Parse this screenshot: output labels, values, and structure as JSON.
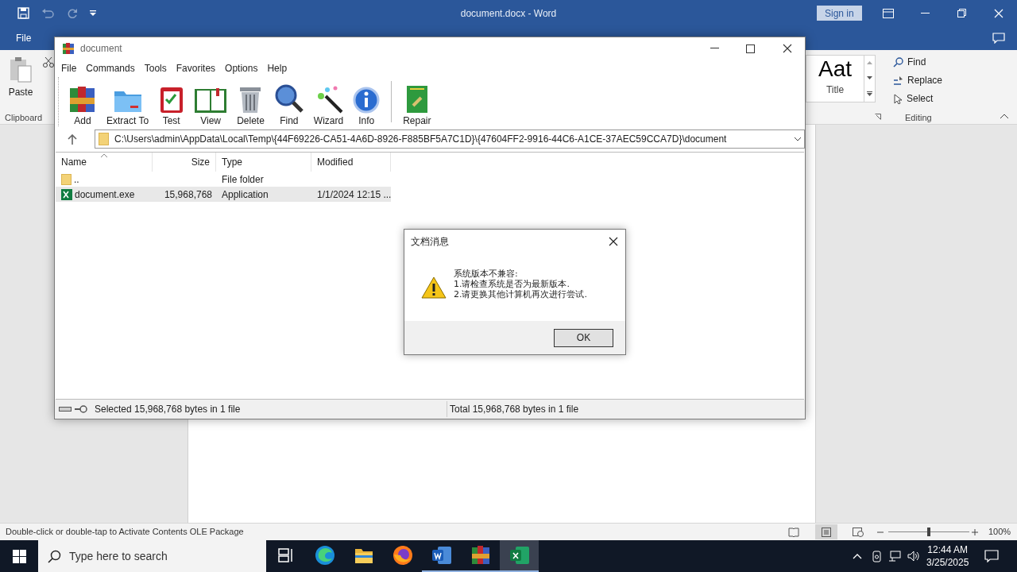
{
  "word": {
    "title": "document.docx  -  Word",
    "sign_in": "Sign in",
    "file_tab": "File",
    "clipboard": {
      "paste": "Paste",
      "label": "Clipboard"
    },
    "styles": {
      "preview": "Aat",
      "name": "Title"
    },
    "editing": {
      "items": [
        "Find",
        "Replace",
        "Select"
      ],
      "label": "Editing"
    },
    "status": "Double-click or double-tap to Activate Contents OLE Package",
    "zoom": {
      "level": 0.5,
      "reading": "100%"
    }
  },
  "winrar": {
    "title": "document",
    "menu": [
      "File",
      "Commands",
      "Tools",
      "Favorites",
      "Options",
      "Help"
    ],
    "toolbar": [
      {
        "kind": "add",
        "label": "Add"
      },
      {
        "kind": "extract",
        "label": "Extract To"
      },
      {
        "kind": "test",
        "label": "Test"
      },
      {
        "kind": "view",
        "label": "View"
      },
      {
        "kind": "delete",
        "label": "Delete"
      },
      {
        "kind": "find",
        "label": "Find"
      },
      {
        "kind": "wizard",
        "label": "Wizard"
      },
      {
        "kind": "info",
        "label": "Info"
      },
      {
        "kind": "repair",
        "label": "Repair"
      }
    ],
    "path": "C:\\Users\\admin\\AppData\\Local\\Temp\\{44F69226-CA51-4A6D-8926-F885BF5A7C1D}\\{47604FF2-9916-44C6-A1CE-37AEC59CCA7D}\\document",
    "columns": [
      "Name",
      "Size",
      "Type",
      "Modified"
    ],
    "rows": [
      {
        "kind": "folder",
        "name": "..",
        "size": "",
        "type": "File folder",
        "modified": "",
        "selected": false
      },
      {
        "kind": "excel",
        "name": "document.exe",
        "size": "15,968,768",
        "type": "Application",
        "modified": "1/1/2024 12:15 ...",
        "selected": true
      }
    ],
    "status_left": "Selected 15,968,768 bytes in 1 file",
    "status_right": "Total 15,968,768 bytes in 1 file"
  },
  "dialog": {
    "title": "文档消息",
    "lines": [
      "系统版本不兼容:",
      "1.请检查系统是否为最新版本.",
      "2.请更换其他计算机再次进行尝试."
    ],
    "button": "OK"
  },
  "taskbar": {
    "search_placeholder": "Type here to search",
    "apps": [
      {
        "kind": "taskview",
        "selected": false
      },
      {
        "kind": "edge",
        "selected": false
      },
      {
        "kind": "explorer",
        "selected": false
      },
      {
        "kind": "firefox",
        "selected": false
      },
      {
        "kind": "word",
        "selected": false
      },
      {
        "kind": "winrar",
        "selected": false
      },
      {
        "kind": "excel",
        "selected": true
      }
    ],
    "time": "12:44 AM",
    "date": "3/25/2025"
  }
}
